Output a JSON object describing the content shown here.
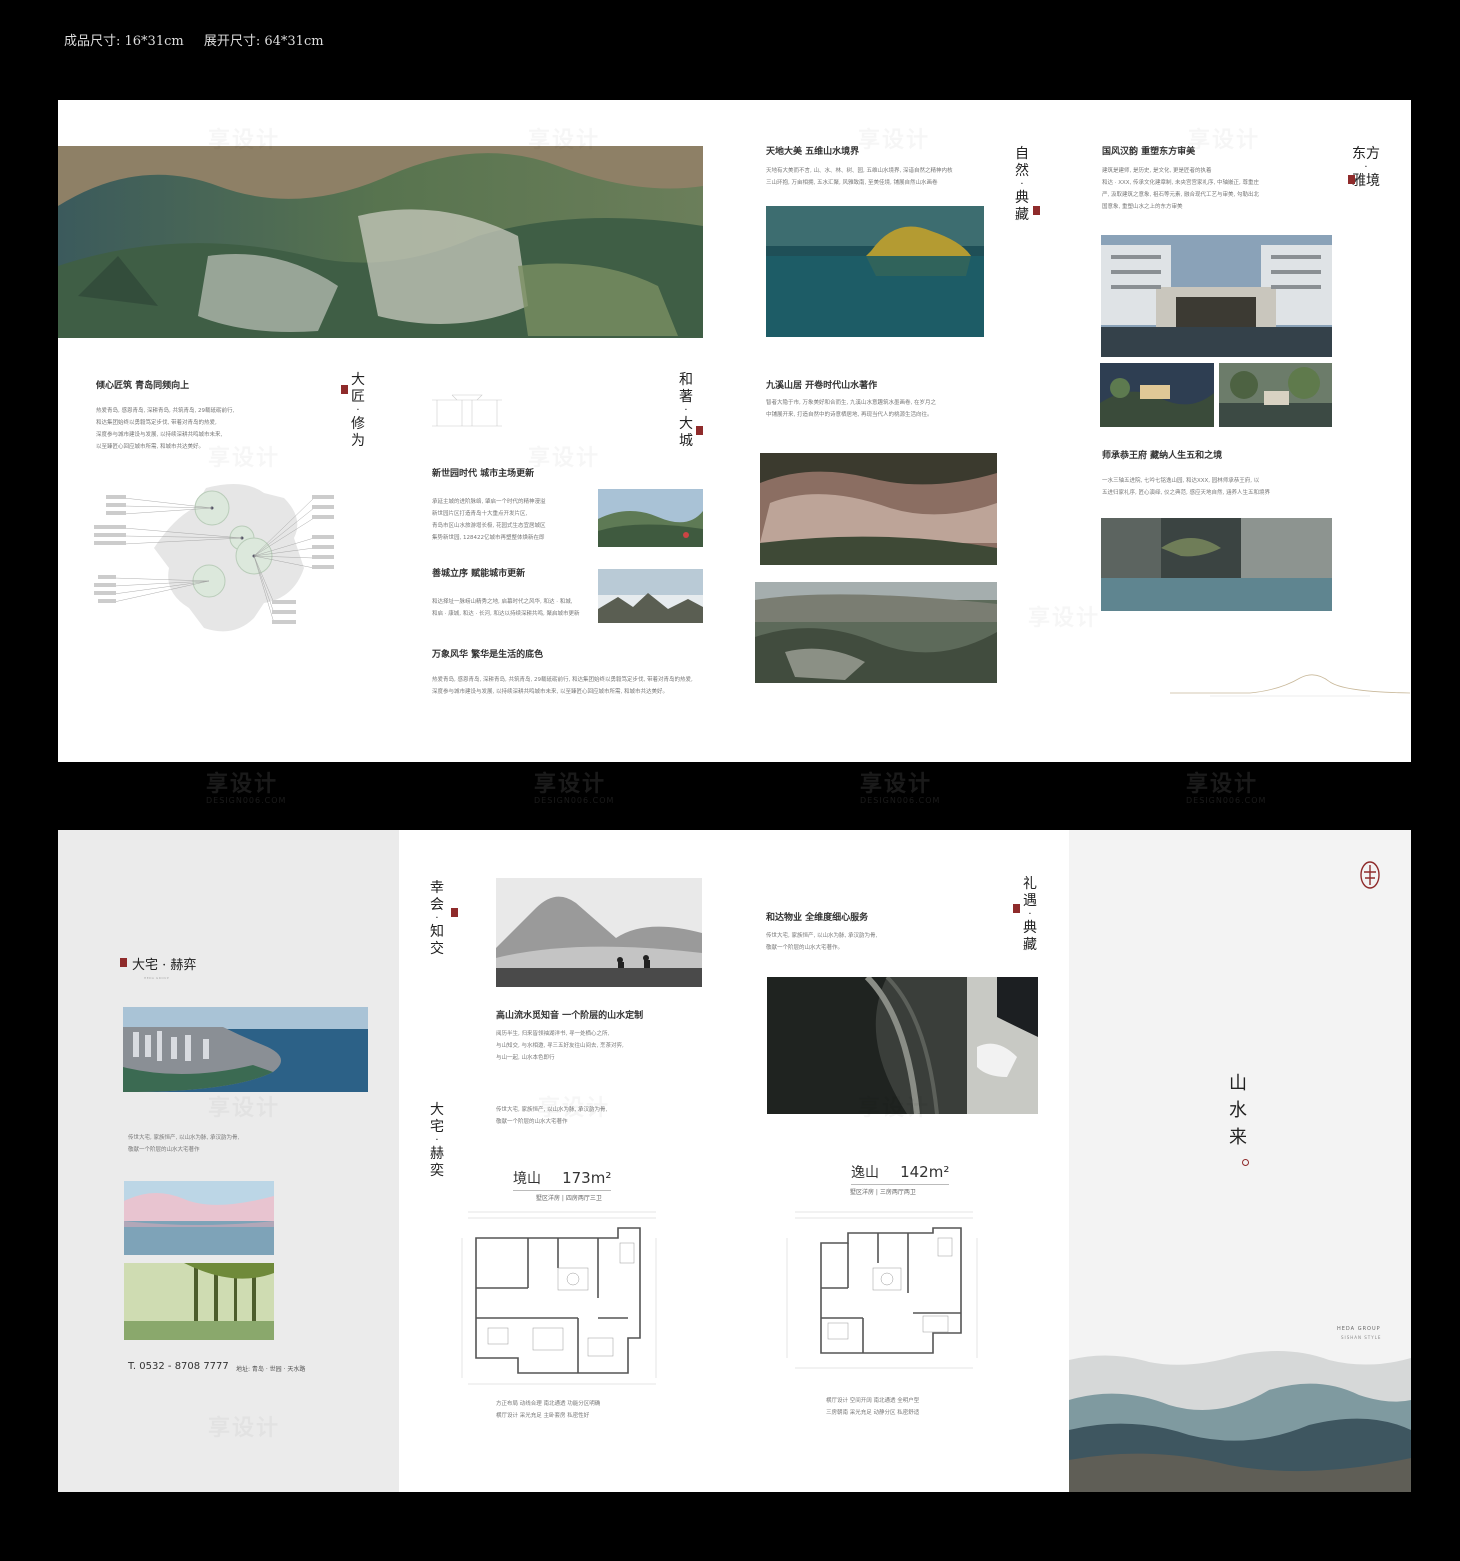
{
  "spec": {
    "finished_size": "成品尺寸: 16*31cm",
    "unfolded_size": "展开尺寸: 64*31cm"
  },
  "watermark": {
    "brand": "享设计",
    "site": "DESIGN006.COM"
  },
  "top": {
    "craft": {
      "title_a": "大匠",
      "title_b": "修为",
      "heading": "倾心匠筑 青岛同频向上",
      "body": [
        "热爱青岛, 感恩青岛, 深耕青岛, 共筑青岛, 29载砥砺前行,",
        "和达集团始终以勇毅笃定步伐, 带着对青岛的热爱,",
        "深度参与城市建设与发展, 以持续深耕共鸣城市未来,",
        "以至臻匠心回应城市所需, 和城市共达美好。"
      ]
    },
    "city": {
      "title_a": "和著",
      "title_b": "大城",
      "s1_heading": "新世园时代 城市主场更新",
      "s1_body": [
        "承延主城的进阶脉络, 肇启一个时代的精神漫溢",
        "新世园片区打造青岛十大重点开发片区,",
        "青岛市区山水旅游增长极, 花园式生态宜居城区",
        "集势新世园, 128422亿城市再塑整体焕新在即"
      ],
      "s2_heading": "善城立序 赋能城市更新",
      "s2_body": [
        "和达择址一脉崂山精秀之地, 启幕时代之风华, 和达 · 和城,",
        "和启 · 康城, 和达 · 长河, 和达以持续深耕共鸣, 聚启城市更新"
      ],
      "s3_heading": "万象风华 繁华是生活的底色",
      "s3_body": [
        "热爱青岛, 感恩青岛, 深耕青岛, 共筑青岛, 29载砥砺前行, 和达集团始终以勇毅笃定步伐, 带着对青岛的热爱,",
        "深度参与城市建设与发展, 以持续深耕共鸣城市未来, 以至臻匠心回应城市所需, 和城市共达美好。"
      ]
    },
    "nature": {
      "title_a": "自然",
      "title_b": "典藏",
      "s1_heading": "天地大美 五维山水境界",
      "s1_body": [
        "天地有大美而不言, 山、水、林、树、园, 五维山水境界, 深谙自然之精神内核",
        "三山环抱, 万亩相拥, 五水汇聚, 风雅致南, 至美佳境, 铺展自然山水画卷"
      ],
      "s2_heading": "九溪山居 开卷时代山水著作",
      "s2_body": [
        "智者大隐于市, 万象美好和合而生, 九溪山水意趣筑水墨画卷, 在岁月之",
        "中铺展开来, 打造自然中的诗意栖居地, 再现当代人的桃源生活向往。"
      ]
    },
    "east": {
      "title_a": "东方",
      "title_b": "雅境",
      "s1_heading": "国风汉韵 重塑东方审美",
      "s1_body": [
        "建筑是建师, 是历史, 是文化, 更是匠者的执着",
        "和达 · XXX, 传承文化建章制, 未央宫宫家礼序, 中轴嵌正, 尊重庄",
        "严, 汲取建筑之意象, 祖石等元素, 融合现代工艺与审美, 勾勒出北",
        "国意象, 重塑山水之上的东方审美"
      ],
      "s2_heading": "师承恭王府 藏纳人生五和之境",
      "s2_body": [
        "一水三轴五进院, 七吟七铭逸山园, 和达XXX, 园林师承恭王府, 以",
        "五进归家礼序, 匠心演绎, 仪之典范, 感应天地自然, 涵养人生五和境界"
      ]
    }
  },
  "bottom": {
    "panel1": {
      "title": "大宅 · 赫弈",
      "sub": "HEDA GROUP",
      "body": [
        "传世大宅, 家族恒产, 以山水为脉, 承汉韵为骨,",
        "敬献一个阶层的山水大宅著作"
      ],
      "tel": "T. 0532 - 8708 7777",
      "address": "地址: 青岛 · 世园 · 天水路"
    },
    "panel2": {
      "title1_a": "幸会",
      "title1_b": "知交",
      "heading": "高山流水觅知音 一个阶层的山水定制",
      "body": [
        "阅历半生, 归来皆领袖湖洋书, 寻一处栖心之所,",
        "与山知交, 与水相邀, 寻三五好友往山间去, 烹茶对弈,",
        "与山一起, 山水本色即行"
      ],
      "title2_a": "大宅",
      "title2_b": "赫奕",
      "body2": [
        "传世大宅, 家族恒产, 以山水为脉, 承汉韵为骨,",
        "敬献一个阶层的山水大宅著作"
      ],
      "plan_name": "境山",
      "plan_area": "173m²",
      "plan_type": "墅区洋房 | 四房两厅三卫",
      "plan_notes": [
        "方正布局 动线合理 南北通透 功能分区明确",
        "横厅设计 采光充足 主卧套房 私密性好"
      ]
    },
    "panel3": {
      "title_a": "礼遇",
      "title_b": "典藏",
      "heading": "和达物业 全维度细心服务",
      "body": [
        "传世大宅, 家族恒产, 以山水为脉, 承汉韵为骨,",
        "敬献一个阶层的山水大宅著作。"
      ],
      "plan_name": "逸山",
      "plan_area": "142m²",
      "plan_type": "墅区洋房 | 三房两厅两卫",
      "plan_notes": [
        "横厅设计 空间开阔 南北通透 全明户型",
        "三房朝南 采光充足 动静分区 私密舒适"
      ]
    },
    "cover": {
      "title": [
        "山",
        "水",
        "来"
      ],
      "brand": "HEDA GROUP",
      "style": "SISHAN STYLE"
    }
  },
  "colors": {
    "background": "#000000",
    "sheet": "#ffffff",
    "panel_grey": "#ebebeb",
    "cover_grey": "#f3f3f3",
    "seal_red": "#8f2b2b"
  }
}
